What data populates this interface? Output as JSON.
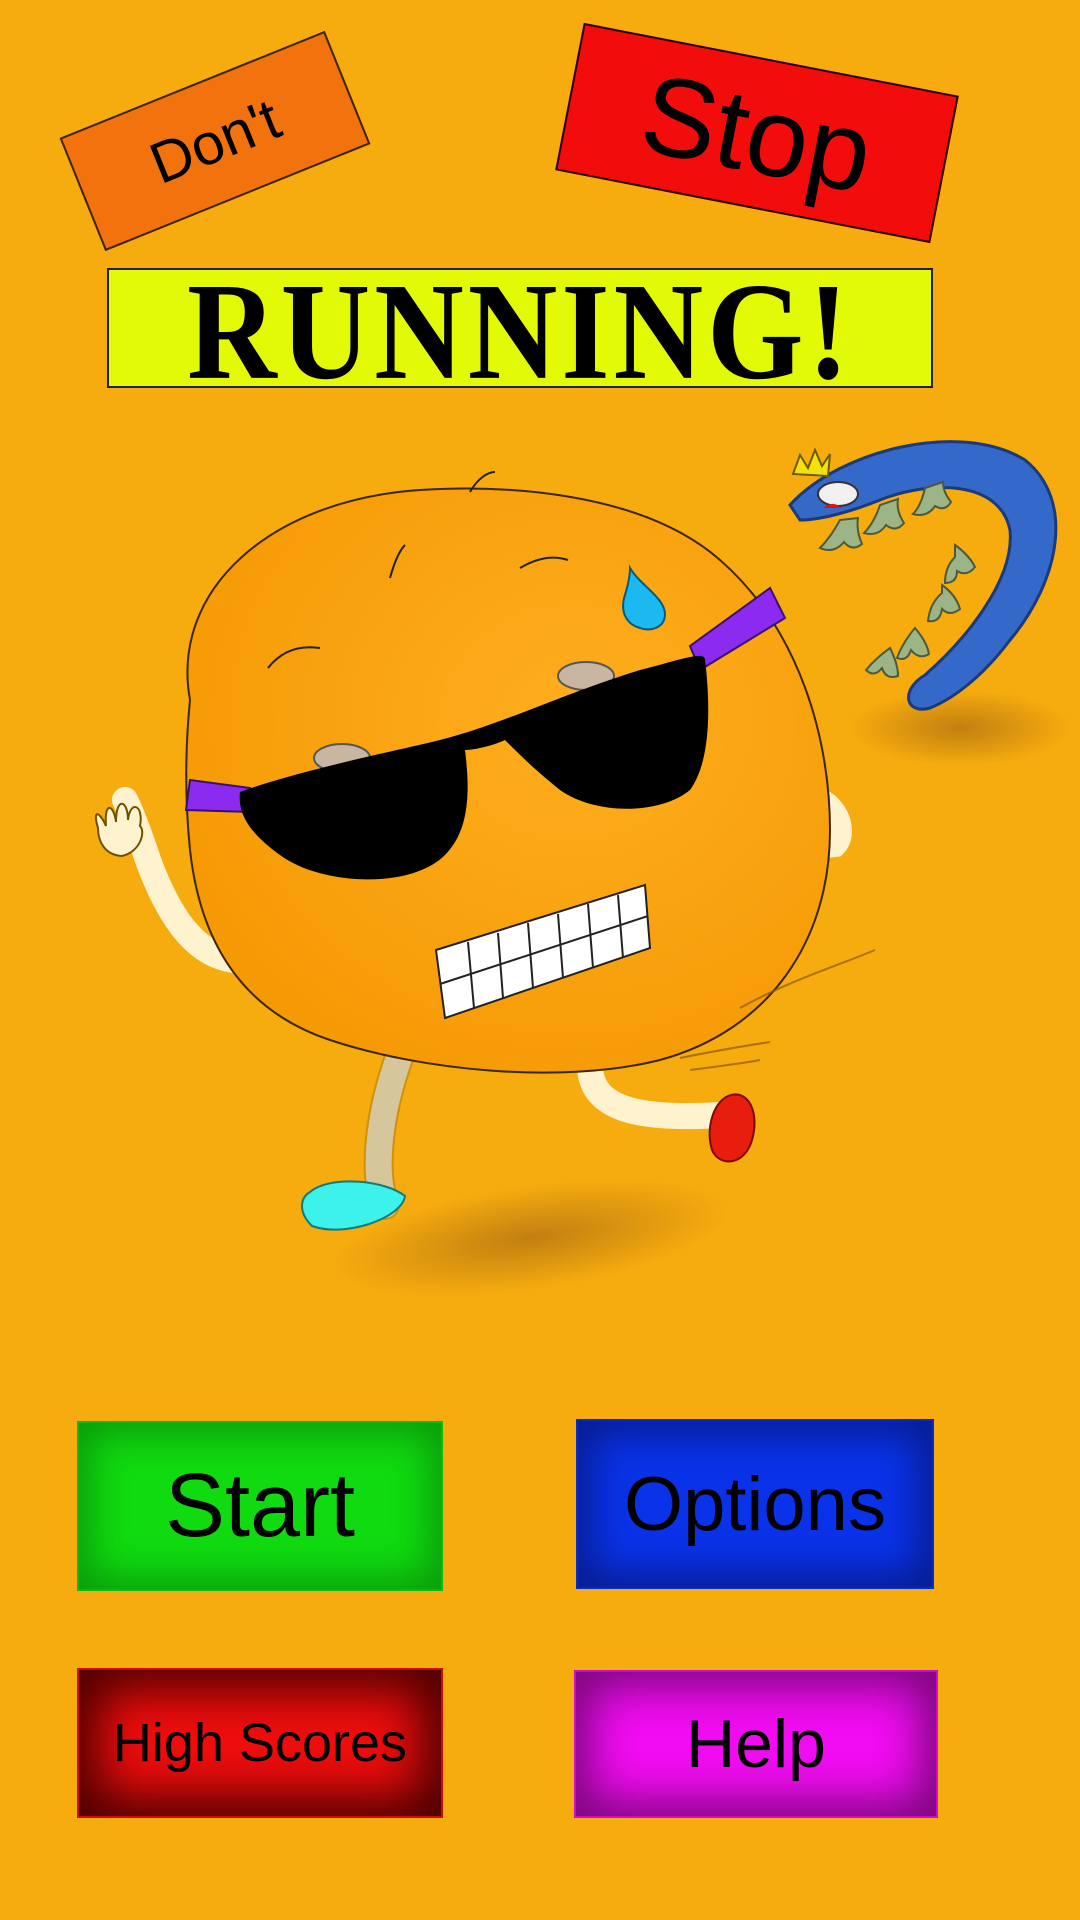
{
  "title": {
    "word1": "Don't",
    "word2": "Stop",
    "word3": "RUNNING!"
  },
  "menu": {
    "start_label": "Start",
    "options_label": "Options",
    "high_scores_label": "High Scores",
    "help_label": "Help"
  },
  "colors": {
    "background": "#F6AC0F",
    "dont_sign": "#F2720E",
    "stop_sign": "#F20C0C",
    "running_sign": "#E2FA06",
    "start_button": "#10DB10",
    "options_button": "#0A32E8",
    "high_scores_button": "#F20D0D",
    "help_button": "#F20CF2"
  },
  "illustration": {
    "main_character": "orange-runner-with-sunglasses",
    "chaser": "blue-crowned-worm-monster"
  }
}
